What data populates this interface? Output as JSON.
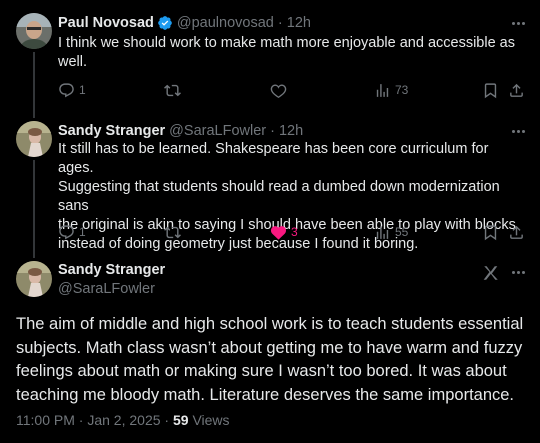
{
  "tweets": [
    {
      "name": "Paul Novosad",
      "verified": true,
      "handle": "@paulnovosad",
      "time": "12h",
      "text_lines": [
        "I think we should work to make math more enjoyable and accessible as",
        "well."
      ],
      "replies": "1",
      "retweets": "",
      "likes": "",
      "views": "73",
      "liked": false
    },
    {
      "name": "Sandy Stranger",
      "verified": false,
      "handle": "@SaraLFowler",
      "time": "12h",
      "text_lines": [
        "It still has to be learned. Shakespeare has been core curriculum for ages.",
        "Suggesting that students should read a dumbed down modernization sans",
        "the original is akin to saying I should have been able to play with blocks",
        "instead of doing geometry just because I found it boring."
      ],
      "replies": "1",
      "retweets": "",
      "likes": "3",
      "views": "55",
      "liked": true
    }
  ],
  "main": {
    "name": "Sandy Stranger",
    "handle": "@SaraLFowler",
    "text_lines": [
      "The aim of middle and high school work is to teach students essential",
      "subjects. Math class wasn’t about getting me to have warm and fuzzy",
      "feelings about math or making sure I wasn’t too bored. It was about",
      "teaching me bloody math. Literature deserves the same importance."
    ],
    "time": "11:00 PM",
    "date": "Jan 2, 2025",
    "views_count": "59",
    "views_label": "Views"
  },
  "colors": {
    "background": "#000000",
    "text": "#e7e9ea",
    "muted": "#71767b",
    "verified": "#1d9bf0",
    "like": "#f91880"
  },
  "icons": [
    "reply-icon",
    "retweet-icon",
    "like-icon",
    "views-icon",
    "bookmark-icon",
    "share-icon",
    "more-icon",
    "verified-icon",
    "grok-icon"
  ]
}
